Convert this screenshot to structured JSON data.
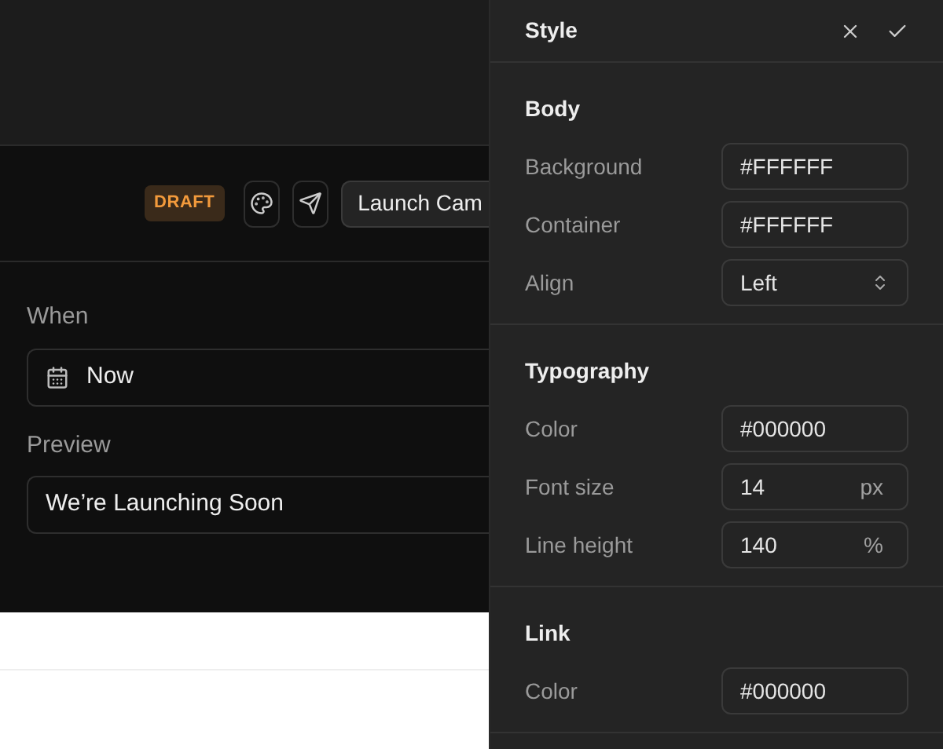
{
  "toolbar": {
    "badge": "DRAFT",
    "launch_button": "Launch Cam"
  },
  "form": [
    {
      "label": "When",
      "value": "Now",
      "kind": "date"
    },
    {
      "label": "Preview",
      "value": "We’re Launching Soon",
      "kind": "text"
    }
  ],
  "panel": {
    "title": "Style",
    "sections": [
      {
        "title": "Body",
        "fields": [
          {
            "label": "Background",
            "value": "#FFFFFF",
            "kind": "text"
          },
          {
            "label": "Container",
            "value": "#FFFFFF",
            "kind": "text"
          },
          {
            "label": "Align",
            "value": "Left",
            "kind": "select"
          }
        ]
      },
      {
        "title": "Typography",
        "fields": [
          {
            "label": "Color",
            "value": "#000000",
            "kind": "text"
          },
          {
            "label": "Font size",
            "value": "14",
            "unit": "px",
            "kind": "unit"
          },
          {
            "label": "Line height",
            "value": "140",
            "unit": "%",
            "kind": "unit"
          }
        ]
      },
      {
        "title": "Link",
        "fields": [
          {
            "label": "Color",
            "value": "#000000",
            "kind": "text"
          }
        ]
      }
    ]
  }
}
